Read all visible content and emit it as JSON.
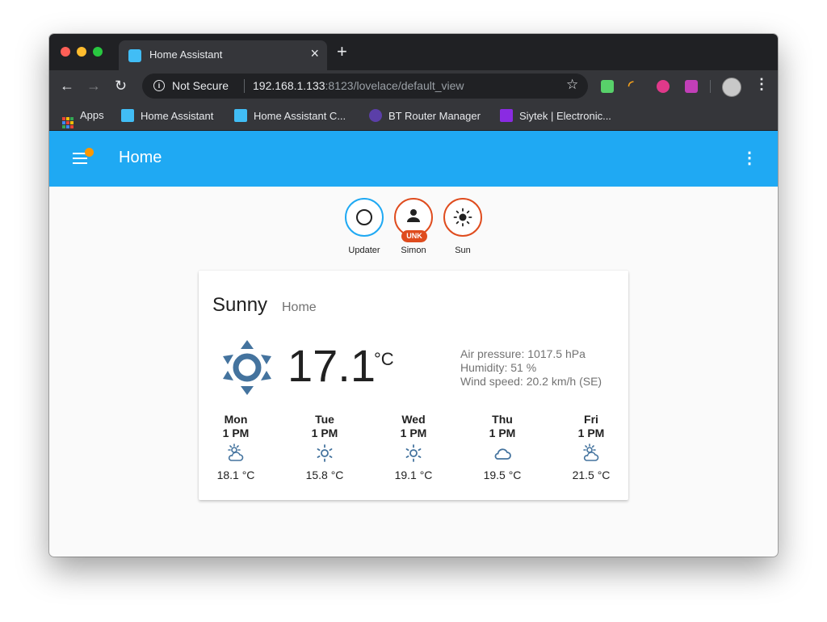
{
  "browser": {
    "tab_title": "Home Assistant",
    "tab_close": "×",
    "new_tab": "+",
    "not_secure": "Not Secure",
    "url_host": "192.168.1.133",
    "url_rest": ":8123/lovelace/default_view",
    "bookmarks": [
      {
        "label": "Apps"
      },
      {
        "label": "Home Assistant"
      },
      {
        "label": "Home Assistant C..."
      },
      {
        "label": "BT Router Manager"
      },
      {
        "label": "Siytek | Electronic..."
      }
    ]
  },
  "ha": {
    "title": "Home",
    "badges": [
      {
        "name": "Updater"
      },
      {
        "name": "Simon",
        "status": "UNK"
      },
      {
        "name": "Sun"
      }
    ]
  },
  "weather": {
    "state": "Sunny",
    "name": "Home",
    "temperature": "17.1",
    "unit": "°C",
    "attributes": [
      "Air pressure: 1017.5 hPa",
      "Humidity: 51 %",
      "Wind speed: 20.2 km/h (SE)"
    ],
    "forecast": [
      {
        "day": "Mon",
        "time": "1 PM",
        "temp": "18.1 °C",
        "icon": "partly-sunny-icon"
      },
      {
        "day": "Tue",
        "time": "1 PM",
        "temp": "15.8 °C",
        "icon": "sun-icon"
      },
      {
        "day": "Wed",
        "time": "1 PM",
        "temp": "19.1 °C",
        "icon": "sun-icon"
      },
      {
        "day": "Thu",
        "time": "1 PM",
        "temp": "19.5 °C",
        "icon": "cloud-icon"
      },
      {
        "day": "Fri",
        "time": "1 PM",
        "temp": "21.5 °C",
        "icon": "partly-sunny-icon"
      }
    ]
  },
  "colors": {
    "header": "#1fa9f3",
    "badge_blue": "#1fa9f3",
    "badge_orange": "#df4c1e",
    "weather_icon": "#44739e"
  }
}
